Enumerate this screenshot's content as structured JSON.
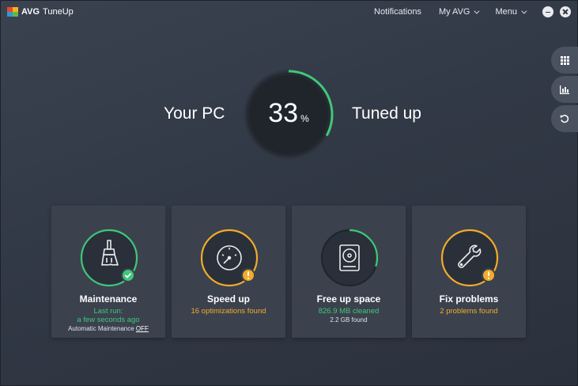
{
  "titlebar": {
    "brand": "AVG",
    "product": "TuneUp",
    "nav": {
      "notifications": "Notifications",
      "my_avg": "My AVG",
      "menu": "Menu"
    }
  },
  "hero": {
    "left_text": "Your PC",
    "right_text": "Tuned up",
    "percent_value": "33",
    "percent_sign": "%",
    "progress_fraction": 0.33
  },
  "side_tools": [
    "grid-icon",
    "chart-icon",
    "undo-icon"
  ],
  "cards": [
    {
      "title": "Maintenance",
      "line1": "Last run:",
      "line2": "a few seconds ago",
      "line3_prefix": "Automatic Maintenance ",
      "line3_link": "OFF",
      "status": "ok",
      "icon": "broom-icon"
    },
    {
      "title": "Speed up",
      "line1": "16 optimizations found",
      "status": "warning",
      "icon": "speedometer-icon"
    },
    {
      "title": "Free up space",
      "line1": "826.9 MB cleaned",
      "line2": "2.2 GB found",
      "status": "partial",
      "progress_fraction": 0.3,
      "icon": "hard-drive-icon"
    },
    {
      "title": "Fix problems",
      "line1": "2 problems found",
      "status": "warning",
      "icon": "wrench-icon"
    }
  ],
  "colors": {
    "green": "#3fc77a",
    "orange": "#f3ab2a",
    "card_bg": "#3b424e"
  }
}
